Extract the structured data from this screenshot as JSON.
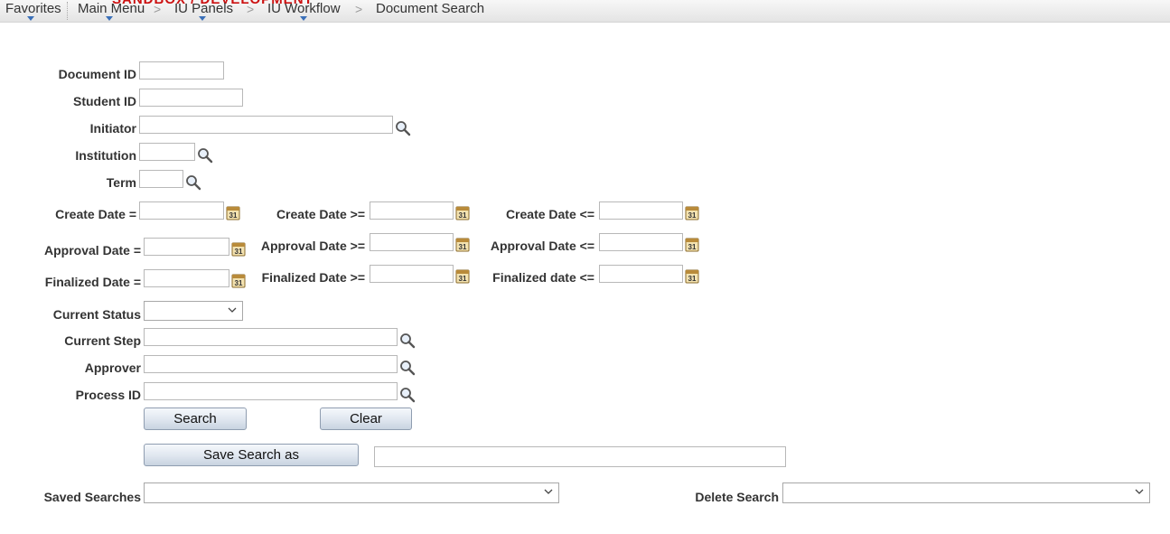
{
  "nav": {
    "banner_text": "SANDBOX / DEVELOPMENT",
    "favorites": "Favorites",
    "main_menu": "Main Menu",
    "iu_panels": "IU Panels",
    "iu_workflow": "IU Workflow",
    "document_search": "Document Search",
    "separator": ">"
  },
  "form": {
    "document_id_label": "Document ID",
    "student_id_label": "Student ID",
    "initiator_label": "Initiator",
    "institution_label": "Institution",
    "term_label": "Term",
    "create_date_eq_label": "Create Date =",
    "create_date_ge_label": "Create Date >=",
    "create_date_le_label": "Create Date <=",
    "approval_date_eq_label": "Approval Date =",
    "approval_date_ge_label": "Approval Date >=",
    "approval_date_le_label": "Approval Date <=",
    "finalized_date_eq_label": "Finalized Date =",
    "finalized_date_ge_label": "Finalized Date >=",
    "finalized_date_le_label": "Finalized date <=",
    "current_status_label": "Current Status",
    "current_step_label": "Current Step",
    "approver_label": "Approver",
    "process_id_label": "Process ID",
    "search_button": "Search",
    "clear_button": "Clear",
    "save_search_button": "Save Search as",
    "saved_searches_label": "Saved Searches",
    "delete_search_label": "Delete Search",
    "calendar_day": "31"
  },
  "values": {
    "document_id": "",
    "student_id": "",
    "initiator": "",
    "institution": "",
    "term": "",
    "create_date_eq": "",
    "create_date_ge": "",
    "create_date_le": "",
    "approval_date_eq": "",
    "approval_date_ge": "",
    "approval_date_le": "",
    "finalized_date_eq": "",
    "finalized_date_ge": "",
    "finalized_date_le": "",
    "current_status": "",
    "current_step": "",
    "approver": "",
    "process_id": "",
    "save_search_name": "",
    "saved_search": "",
    "delete_search": ""
  },
  "icons": {
    "lookup": "magnifier-icon",
    "calendar": "calendar-icon",
    "dropdown": "chevron-down-icon"
  },
  "colors": {
    "nav_arrow": "#3a6fb8",
    "banner": "#cc1111",
    "button_border": "#8f9db0"
  }
}
